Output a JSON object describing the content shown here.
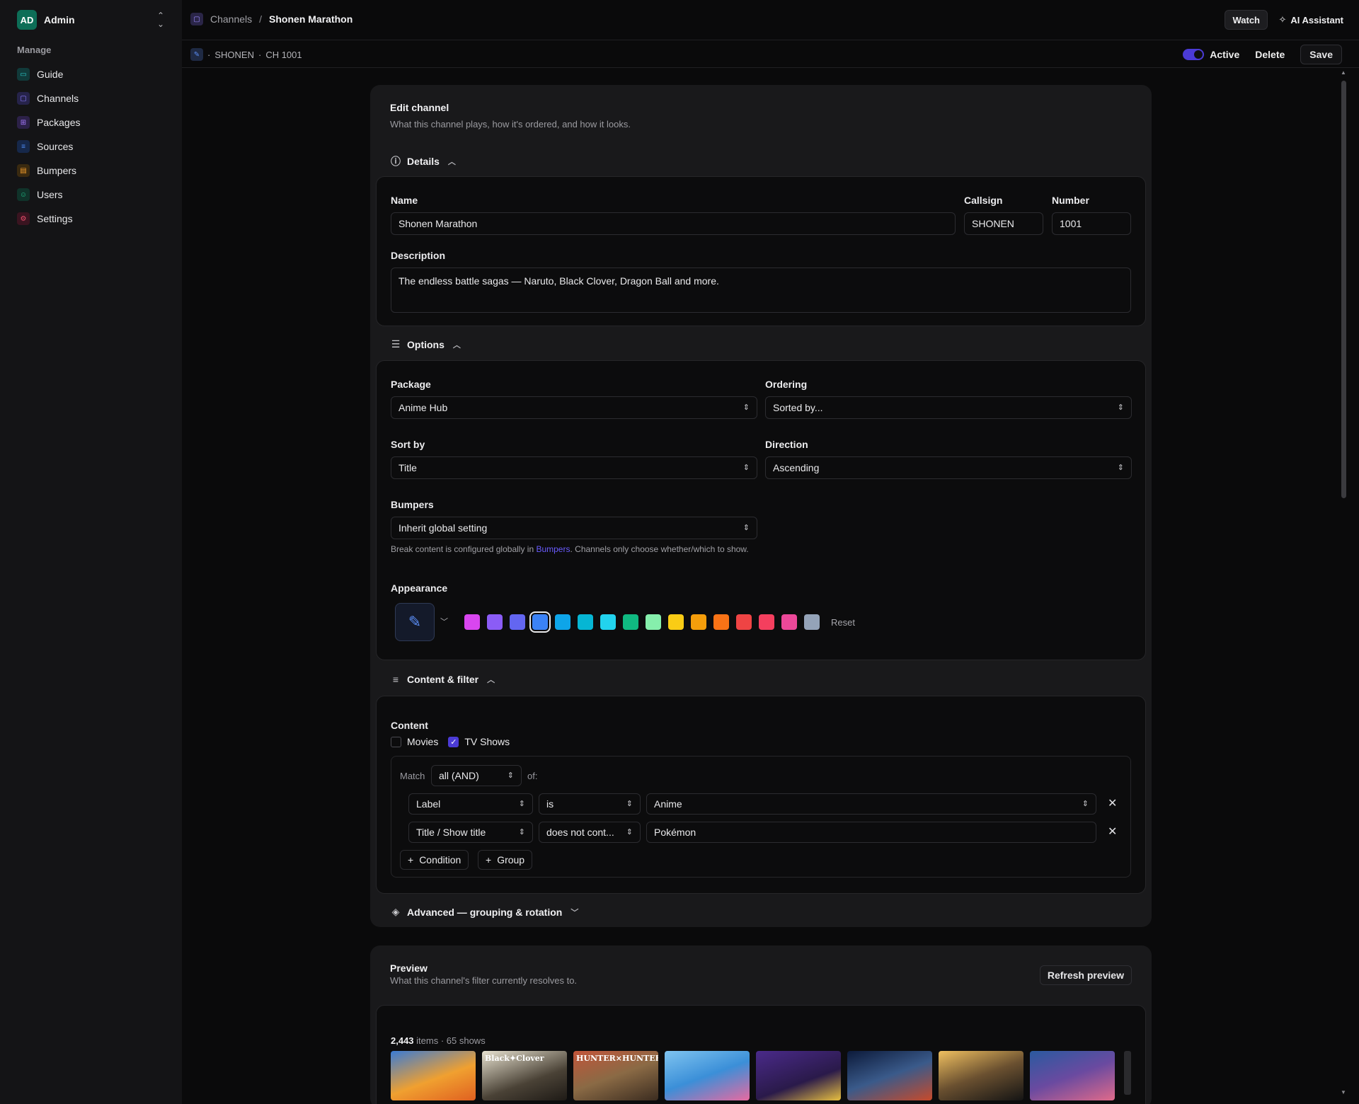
{
  "sidebar": {
    "avatar_initials": "AD",
    "user": "Admin",
    "section_label": "Manage",
    "items": [
      {
        "label": "Guide",
        "icon": "monitor-icon",
        "color": "#2cc7c7"
      },
      {
        "label": "Channels",
        "icon": "tv-icon",
        "color": "#8b7cff"
      },
      {
        "label": "Packages",
        "icon": "grid-icon",
        "color": "#a77bff"
      },
      {
        "label": "Sources",
        "icon": "database-icon",
        "color": "#4f8ef7"
      },
      {
        "label": "Bumpers",
        "icon": "film-icon",
        "color": "#f59e2b"
      },
      {
        "label": "Users",
        "icon": "users-icon",
        "color": "#22c08a"
      },
      {
        "label": "Settings",
        "icon": "gear-icon",
        "color": "#f0506e"
      }
    ]
  },
  "topbar": {
    "breadcrumb_root": "Channels",
    "breadcrumb_sep": "/",
    "breadcrumb_current": "Shonen Marathon",
    "watch_label": "Watch",
    "ai_label": "AI Assistant"
  },
  "subbar": {
    "callsign": "SHONEN",
    "dot": "·",
    "channel_number": "CH 1001",
    "active_label": "Active",
    "active": true,
    "delete_label": "Delete",
    "save_label": "Save"
  },
  "edit": {
    "title": "Edit channel",
    "subtitle": "What this channel plays, how it's ordered, and how it looks.",
    "details": {
      "heading": "Details",
      "name_label": "Name",
      "name_value": "Shonen Marathon",
      "callsign_label": "Callsign",
      "callsign_value": "SHONEN",
      "number_label": "Number",
      "number_value": "1001",
      "description_label": "Description",
      "description_value": "The endless battle sagas — Naruto, Black Clover, Dragon Ball and more."
    },
    "options": {
      "heading": "Options",
      "package_label": "Package",
      "package_value": "Anime Hub",
      "ordering_label": "Ordering",
      "ordering_value": "Sorted by...",
      "sortby_label": "Sort by",
      "sortby_value": "Title",
      "direction_label": "Direction",
      "direction_value": "Ascending",
      "bumpers_label": "Bumpers",
      "bumpers_value": "Inherit global setting",
      "bumpers_help_1": "Break content is configured globally in ",
      "bumpers_help_link": "Bumpers",
      "bumpers_help_2": ". Channels only choose whether/which to show.",
      "appearance_label": "Appearance",
      "reset_label": "Reset",
      "swatches": [
        "#d946ef",
        "#8b5cf6",
        "#6366f1",
        "#3b82f6",
        "#0ea5e9",
        "#06b6d4",
        "#22d3ee",
        "#10b981",
        "#86efac",
        "#facc15",
        "#f59e0b",
        "#f97316",
        "#ef4444",
        "#f43f5e",
        "#ec4899",
        "#94a3b8"
      ],
      "selected_swatch": 3
    },
    "content": {
      "heading": "Content & filter",
      "content_label": "Content",
      "movies_label": "Movies",
      "movies_checked": false,
      "tv_label": "TV Shows",
      "tv_checked": true,
      "match_label": "Match",
      "match_value": "all (AND)",
      "of_label": "of:",
      "rules": [
        {
          "field": "Label",
          "op": "is",
          "value": "Anime"
        },
        {
          "field": "Title / Show title",
          "op": "does not cont...",
          "value": "Pokémon"
        }
      ],
      "add_condition": "Condition",
      "add_group": "Group"
    },
    "advanced": {
      "heading": "Advanced — grouping & rotation"
    }
  },
  "preview": {
    "title": "Preview",
    "subtitle": "What this channel's filter currently resolves to.",
    "refresh_label": "Refresh preview",
    "items_count": "2,443",
    "items_suffix": " items · 65 shows",
    "thumbs": [
      {
        "label": "",
        "bg": "linear-gradient(160deg,#3a7bd5 0%,#f0a030 55%,#e06020 100%)"
      },
      {
        "label": "Black✦Clover",
        "bg": "linear-gradient(160deg,#e8e2d0 0%,#4a4236 60%,#1e1a16 100%)"
      },
      {
        "label": "HUNTER×HUNTER",
        "bg": "linear-gradient(160deg,#c2553a 0%,#8a6a45 50%,#3b2c20 100%)"
      },
      {
        "label": "",
        "bg": "linear-gradient(160deg,#7fc4f0 0%,#3b8fd8 50%,#e86aa0 100%)"
      },
      {
        "label": "",
        "bg": "linear-gradient(160deg,#4a2a8a 0%,#2a1a4a 60%,#e8c040 100%)"
      },
      {
        "label": "",
        "bg": "linear-gradient(160deg,#0c1a3a 0%,#3a5a8a 50%,#c84a2a 100%)"
      },
      {
        "label": "",
        "bg": "linear-gradient(160deg,#f0c060 0%,#6a5030 50%,#141414 100%)"
      },
      {
        "label": "",
        "bg": "linear-gradient(160deg,#2a5aa0 0%,#6a4aa0 50%,#e06a8a 100%)"
      }
    ]
  }
}
